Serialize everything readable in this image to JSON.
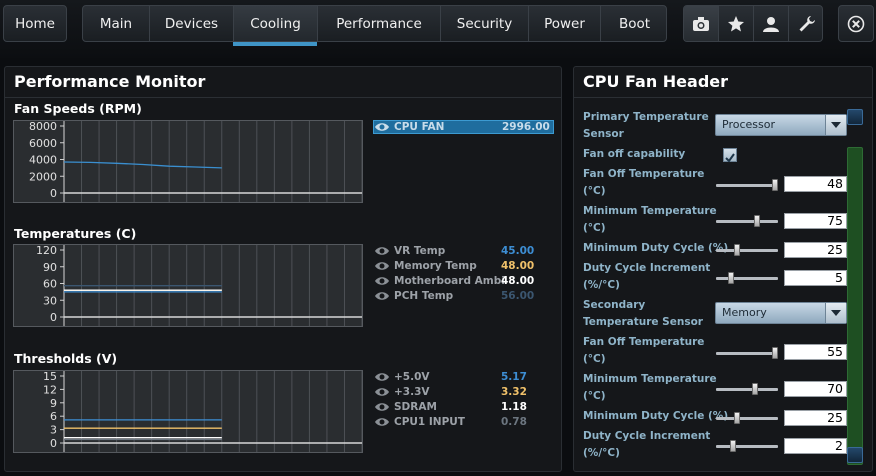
{
  "nav": {
    "home": "Home",
    "tabs": [
      "Main",
      "Devices",
      "Cooling",
      "Performance",
      "Security",
      "Power",
      "Boot"
    ],
    "active_tab": "Cooling",
    "icons": [
      "camera-icon",
      "star-icon",
      "user-icon",
      "wrench-icon"
    ],
    "close_icon": "close-icon"
  },
  "monitor": {
    "title": "Performance Monitor",
    "fan": {
      "title": "Fan Speeds (RPM)",
      "legend": [
        {
          "name": "CPU FAN",
          "value": "2996.00",
          "color": "#3a8fd0",
          "selected": true
        }
      ]
    },
    "temps": {
      "title": "Temperatures (C)",
      "legend": [
        {
          "name": "VR Temp",
          "value": "45.00",
          "color": "#3d8ed4"
        },
        {
          "name": "Memory Temp",
          "value": "48.00",
          "color": "#f0c16a"
        },
        {
          "name": "Motherboard Ambi",
          "value": "48.00",
          "color": "#ffffff"
        },
        {
          "name": "PCH Temp",
          "value": "56.00",
          "color": "#3b5670"
        }
      ]
    },
    "volts": {
      "title": "Thresholds (V)",
      "legend": [
        {
          "name": "+5.0V",
          "value": "5.17",
          "color": "#3d8ed4"
        },
        {
          "name": "+3.3V",
          "value": "3.32",
          "color": "#f0c16a"
        },
        {
          "name": "SDRAM",
          "value": "1.18",
          "color": "#ffffff"
        },
        {
          "name": "CPU1 INPUT",
          "value": "0.78",
          "color": "#6c7680"
        }
      ]
    }
  },
  "chart_data": [
    {
      "type": "line",
      "title": "Fan Speeds (RPM)",
      "yticks": [
        "8000",
        "6000",
        "4000",
        "2000",
        "0"
      ],
      "ylim": [
        0,
        8000
      ],
      "series": [
        {
          "name": "CPU FAN",
          "values": [
            3700,
            3650,
            3550,
            3400,
            3200,
            3100,
            2996
          ]
        }
      ]
    },
    {
      "type": "line",
      "title": "Temperatures (C)",
      "yticks": [
        "120",
        "90",
        "60",
        "30",
        "0"
      ],
      "ylim": [
        0,
        120
      ],
      "series": [
        {
          "name": "VR Temp",
          "values": [
            45,
            45,
            45,
            45,
            45,
            45,
            45
          ]
        },
        {
          "name": "Memory Temp",
          "values": [
            48,
            48,
            48,
            48,
            48,
            48,
            48
          ]
        },
        {
          "name": "Motherboard Ambi",
          "values": [
            48,
            48,
            48,
            48,
            48,
            48,
            48
          ]
        },
        {
          "name": "PCH Temp",
          "values": [
            56,
            56,
            56,
            56,
            56,
            56,
            56
          ]
        }
      ]
    },
    {
      "type": "line",
      "title": "Thresholds (V)",
      "yticks": [
        "15",
        "12",
        "9",
        "6",
        "3",
        "0"
      ],
      "ylim": [
        0,
        15
      ],
      "series": [
        {
          "name": "+5.0V",
          "values": [
            5.17,
            5.17,
            5.17,
            5.17,
            5.17,
            5.17,
            5.17
          ]
        },
        {
          "name": "+3.3V",
          "values": [
            3.32,
            3.32,
            3.32,
            3.32,
            3.32,
            3.32,
            3.32
          ]
        },
        {
          "name": "SDRAM",
          "values": [
            1.18,
            1.18,
            1.18,
            1.18,
            1.18,
            1.18,
            1.18
          ]
        },
        {
          "name": "CPU1 INPUT",
          "values": [
            0.78,
            0.78,
            0.78,
            0.78,
            0.78,
            0.78,
            0.78
          ]
        }
      ]
    }
  ],
  "fan_header": {
    "title": "CPU Fan Header",
    "primary_sensor_label_1": "Primary Temperature",
    "primary_sensor_label_2": "Sensor",
    "primary_sensor_value": "Processor",
    "fan_off_label": "Fan off capability",
    "fan_off_checked": true,
    "p_fan_off_temp_1": "Fan Off Temperature",
    "p_fan_off_temp_2": "(°C)",
    "p_fan_off_temp_val": "48",
    "p_min_temp_1": "Minimum Temperature",
    "p_min_temp_2": "(°C)",
    "p_min_temp_val": "75",
    "p_min_duty": "Minimum Duty Cycle (%)",
    "p_min_duty_val": "25",
    "p_duty_inc_1": "Duty Cycle Increment",
    "p_duty_inc_2": "(%/°C)",
    "p_duty_inc_val": "5",
    "secondary_sensor_label_1": "Secondary",
    "secondary_sensor_label_2": "Temperature Sensor",
    "secondary_sensor_value": "Memory",
    "s_fan_off_temp_1": "Fan Off Temperature",
    "s_fan_off_temp_2": "(°C)",
    "s_fan_off_temp_val": "55",
    "s_min_temp_1": "Minimum Temperature",
    "s_min_temp_2": "(°C)",
    "s_min_temp_val": "70",
    "s_min_duty": "Minimum Duty Cycle (%)",
    "s_min_duty_val": "25",
    "s_duty_inc_1": "Duty Cycle Increment",
    "s_duty_inc_2": "(%/°C)",
    "s_duty_inc_val": "2"
  }
}
